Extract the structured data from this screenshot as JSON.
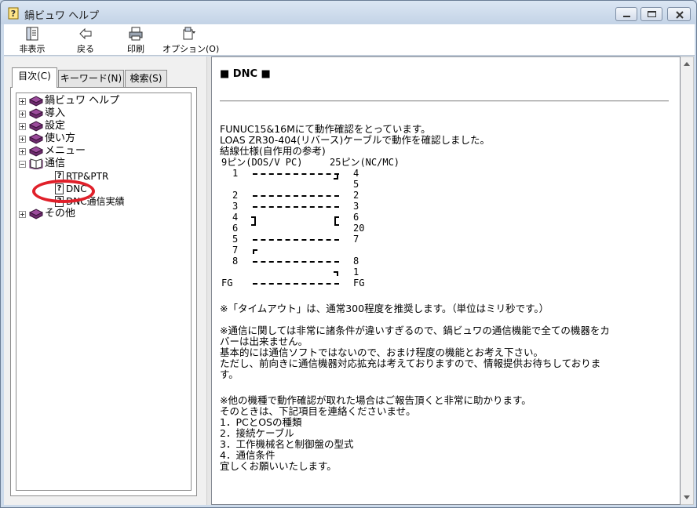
{
  "window": {
    "title": "鍋ビュワ ヘルプ"
  },
  "toolbar": {
    "hide_label": "非表示",
    "back_label": "戻る",
    "print_label": "印刷",
    "options_label": "オプション(O)"
  },
  "tabs": [
    {
      "label": "目次(C)"
    },
    {
      "label": "キーワード(N)"
    },
    {
      "label": "検索(S)"
    }
  ],
  "tree": {
    "items": [
      {
        "label": "鍋ビュワ ヘルプ"
      },
      {
        "label": "導入"
      },
      {
        "label": "設定"
      },
      {
        "label": "使い方"
      },
      {
        "label": "メニュー"
      },
      {
        "label": "通信"
      },
      {
        "label": "RTP&PTR"
      },
      {
        "label": "DNC"
      },
      {
        "label": "DNC通信実績"
      },
      {
        "label": "その他"
      }
    ]
  },
  "content": {
    "heading": "■ DNC ■",
    "intro": [
      "FUNUC15&16Mにて動作確認をとっています。",
      "LOAS ZR30-404(リバース)ケーブルで動作を確認しました。",
      "結線仕様(自作用の参考)"
    ],
    "pin_header_left": "9ピン(DOS/V PC)",
    "pin_header_right": "25ピン(NC/MC)",
    "pins_left": [
      "1",
      "2",
      "3",
      "4",
      "6",
      "5",
      "7",
      "8",
      "FG"
    ],
    "pins_right": [
      "4",
      "5",
      "2",
      "3",
      "6",
      "20",
      "7",
      "8",
      "1",
      "FG"
    ],
    "timeout_note": "※「タイムアウト」は、通常300程度を推奨します。（単位はミリ秒です。）",
    "comm_note": [
      "※通信に関しては非常に諸条件が違いすぎるので、鍋ビュワの通信機能で全ての機器をカ",
      "バーは出来ません。",
      "基本的には通信ソフトではないので、おまけ程度の機能とお考え下さい。",
      "ただし、前向きに通信機器対応拡充は考えておりますので、情報提供お待ちしておりま",
      "す。"
    ],
    "report_note": [
      "※他の機種で動作確認が取れた場合はご報告頂くと非常に助かります。",
      "そのときは、下記項目を連絡くださいませ。",
      "1．PCとOSの種類",
      "2．接続ケーブル",
      "3．工作機械名と制御盤の型式",
      "4．通信条件",
      "宜しくお願いいたします。"
    ]
  },
  "colors": {
    "highlight_circle": "#e0202a",
    "book_icon": "#7a2e7a"
  }
}
